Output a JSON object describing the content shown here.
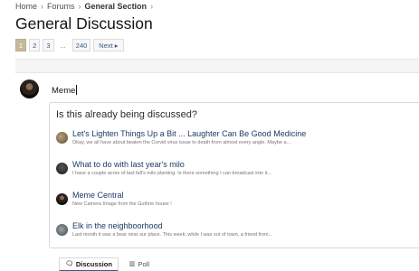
{
  "breadcrumb": {
    "home": "Home",
    "forums": "Forums",
    "section": "General Section"
  },
  "page_title": "General Discussion",
  "pagination": {
    "pages": [
      "1",
      "2",
      "3",
      "...",
      "240"
    ],
    "current": "1",
    "next_label": "Next ▸"
  },
  "editor": {
    "value": "Meme"
  },
  "suggestions": {
    "title": "Is this already being discussed?",
    "items": [
      {
        "title": "Let's Lighten Things Up a Bit ... Laughter Can Be Good Medicine",
        "snippet": "Okay, we all have about beaten the Corvid virus issue to death from almost every angle. Maybe a..."
      },
      {
        "title": "What to do with last year's milo",
        "snippet": "I have a couple acres of last fall's milo planting. Is there something I can broadcast into it..."
      },
      {
        "title": "Meme Central",
        "snippet": "New Camera Image from the Guthrie house !"
      },
      {
        "title": "Elk in the neighboorhood",
        "snippet": "Last month it was a bear near our place. This week, while I was out of town, a friend from..."
      }
    ]
  },
  "tabs": {
    "discussion": "Discussion",
    "poll": "Poll"
  },
  "colors": {
    "link": "#1d3a66",
    "pager_active": "#c6b99a"
  }
}
